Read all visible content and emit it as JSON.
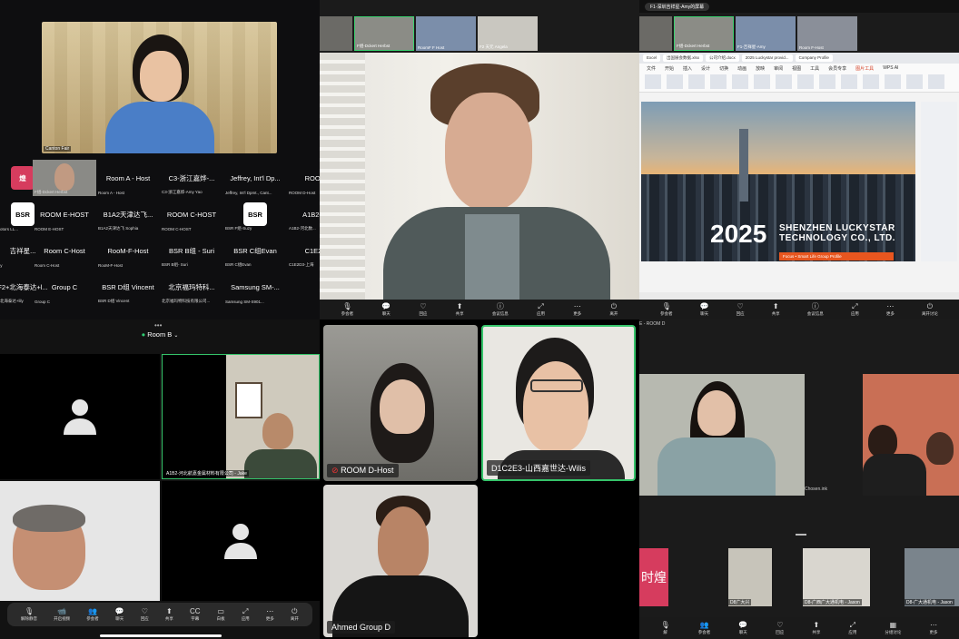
{
  "q1": {
    "speaker_tag": "Canton Fair",
    "rows": [
      [
        {
          "name": "煌",
          "sub": "ure",
          "logo": true,
          "logo_bg": "#d63c5e"
        },
        {
          "name": "",
          "sub": "F组-Dckert Herbst",
          "video": true
        },
        {
          "name": "Room A - Host",
          "sub": "Room A - Host"
        },
        {
          "name": "C3-浙江嘉烨-...",
          "sub": "C3-浙江嘉烨-Amy Yao"
        },
        {
          "name": "Jeffrey, Int'l Dp...",
          "sub": "Jeffrey, Int'l Dpmt., Cant..."
        },
        {
          "name": "ROOM D",
          "sub": "ROOM D-Host"
        }
      ],
      [
        {
          "name": "BSR",
          "sub": "S Motors LL...",
          "logo": true,
          "logo_bg": "#fff",
          "logo_fg": "#000"
        },
        {
          "name": "ROOM E-HOST",
          "sub": "ROOM E-HOST"
        },
        {
          "name": "B1A2天津达飞...",
          "sub": "B1A2天津达飞 Sophia"
        },
        {
          "name": "ROOM C-HOST",
          "sub": "ROOM C-HOST"
        },
        {
          "name": "BSR",
          "sub": "BSR F组-Suzy",
          "logo": true,
          "logo_bg": "#fff",
          "logo_fg": "#000"
        },
        {
          "name": "A1B2-河北",
          "sub": "A1B2-河北数..."
        }
      ],
      [
        {
          "name": "吉祥星...",
          "sub": "-Amy"
        },
        {
          "name": "Room C-Host",
          "sub": "Room C-Host"
        },
        {
          "name": "RooM-F-Host",
          "sub": "RooM-F-Host"
        },
        {
          "name": "BSR B组 - Suri",
          "sub": "BSR B组- Suri"
        },
        {
          "name": "BSR C组Evan",
          "sub": "BSR C组Evan"
        },
        {
          "name": "C1E2D3-",
          "sub": "C1E2D3-上海"
        }
      ],
      [
        {
          "name": "F2+北海泰达+l...",
          "sub": "F2+北海泰达+lily"
        },
        {
          "name": "Group C",
          "sub": "Group C"
        },
        {
          "name": "BSR D组 Vincent",
          "sub": "BSR D组 Vincent"
        },
        {
          "name": "北京福玛特科...",
          "sub": "北京福玛特科技有限公司..."
        },
        {
          "name": "Samsung SM-...",
          "sub": "Samsung SM-S901..."
        },
        {
          "name": "",
          "sub": ""
        }
      ]
    ]
  },
  "q2": {
    "thumbs": [
      "",
      "F组-Dckert Herbst",
      "RoomF F Host",
      "F2 天元 Angela"
    ],
    "toolbar": [
      {
        "icon": "🎙",
        "label": "参会者"
      },
      {
        "icon": "💬",
        "label": "聊天"
      },
      {
        "icon": "♡",
        "label": "回应"
      },
      {
        "icon": "⬆",
        "label": "共享"
      },
      {
        "icon": "ⓘ",
        "label": "会议信息"
      },
      {
        "icon": "⤢",
        "label": "应用"
      },
      {
        "icon": "⋯",
        "label": "更多"
      },
      {
        "icon": "⏻",
        "label": "离开"
      }
    ]
  },
  "q3": {
    "window_title": "F1-深圳吉祥星-Amy的屏幕",
    "thumbs": [
      "",
      "F组-Dckert Herbst",
      "F1-吉祥星-Amy",
      "Room F-Host"
    ],
    "tabs": [
      "Excel",
      "出国展会数据.xlsx",
      "公司介绍.docx",
      "2025 Luckystar provid...",
      "Company Profile"
    ],
    "menu": [
      "文件",
      "开始",
      "插入",
      "设计",
      "切换",
      "动画",
      "放映",
      "审阅",
      "视图",
      "工具",
      "会员专享",
      "图片工具",
      "WPS AI"
    ],
    "slide": {
      "year": "2025",
      "company_line1": "SHENZHEN LUCKYSTAR",
      "company_line2": "TECHNOLOGY CO., LTD.",
      "bar_text": "Focus • Smart Life    Group Profile"
    },
    "toolbar": [
      {
        "icon": "🎙",
        "label": "参会者"
      },
      {
        "icon": "💬",
        "label": "聊天"
      },
      {
        "icon": "♡",
        "label": "回应"
      },
      {
        "icon": "⬆",
        "label": "共享"
      },
      {
        "icon": "ⓘ",
        "label": "会议信息"
      },
      {
        "icon": "⤢",
        "label": "应用"
      },
      {
        "icon": "⋯",
        "label": "更多"
      },
      {
        "icon": "⏻",
        "label": "离开讨论"
      }
    ]
  },
  "q4": {
    "room": "Room B",
    "tile_video_label": "A1B2-河北航嘉金属材料有限公司 - Jake",
    "toolbar": [
      {
        "icon": "🎙",
        "label": "解除静音"
      },
      {
        "icon": "📹",
        "label": "开启视频"
      },
      {
        "icon": "👥",
        "label": "参会者"
      },
      {
        "icon": "💬",
        "label": "聊天"
      },
      {
        "icon": "♡",
        "label": "回应"
      },
      {
        "icon": "⬆",
        "label": "共享"
      },
      {
        "icon": "CC",
        "label": "字幕"
      },
      {
        "icon": "▭",
        "label": "白板"
      },
      {
        "icon": "⤢",
        "label": "应用"
      },
      {
        "icon": "⋯",
        "label": "更多"
      },
      {
        "icon": "⏻",
        "label": "离开"
      }
    ]
  },
  "q5": {
    "tiles": [
      {
        "name": "ROOM D-Host",
        "muted": true
      },
      {
        "name": "D1C2E3-山西嘉世达-Wilis",
        "muted": false
      },
      {
        "name": "Ahmed Group D",
        "muted": false
      }
    ]
  },
  "q6": {
    "header": "E - ROOM D",
    "chosen_label": "Chosen.ink",
    "bottom": [
      "D8广大兴",
      "D8-广西广大通机电 - Jason",
      "D8-广大通机电 - Jason"
    ],
    "logo_text": "时煌",
    "toolbar": [
      {
        "icon": "🎙",
        "label": "解"
      },
      {
        "icon": "👥",
        "label": "参会者"
      },
      {
        "icon": "💬",
        "label": "聊天"
      },
      {
        "icon": "♡",
        "label": "回应"
      },
      {
        "icon": "⬆",
        "label": "共享"
      },
      {
        "icon": "⤢",
        "label": "应用"
      },
      {
        "icon": "▦",
        "label": "分组讨论"
      },
      {
        "icon": "⋯",
        "label": "更多"
      }
    ]
  }
}
